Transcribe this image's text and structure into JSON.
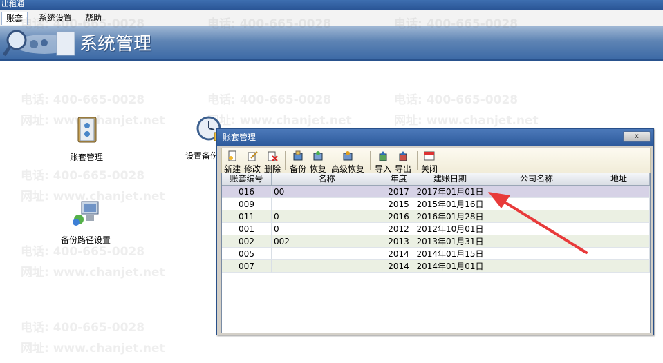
{
  "app": {
    "window_title": "出租通"
  },
  "menu": {
    "items": [
      "账套",
      "系统设置",
      "帮助"
    ]
  },
  "banner": {
    "title": "系统管理"
  },
  "watermark": {
    "phone": "电话: 400-665-0028",
    "site": "网址: www.chanjet.net"
  },
  "desktop": {
    "account_mgmt": "账套管理",
    "backup_settings": "设置备份",
    "backup_path": "备份路径设置"
  },
  "dialog": {
    "title": "账套管理",
    "close_label": "x",
    "toolbar": {
      "new": "新建",
      "edit": "修改",
      "delete": "删除",
      "backup": "备份",
      "restore": "恢复",
      "advanced_restore": "高级恢复",
      "import": "导入",
      "export": "导出",
      "close": "关闭"
    },
    "columns": [
      "账套编号",
      "名称",
      "年度",
      "建账日期",
      "公司名称",
      "地址"
    ],
    "rows": [
      {
        "code": "016",
        "name": "00",
        "year": "2017",
        "date": "2017年01月01日",
        "company": "",
        "address": ""
      },
      {
        "code": "009",
        "name": "",
        "year": "2015",
        "date": "2015年01月16日",
        "company": "",
        "address": ""
      },
      {
        "code": "011",
        "name": "0",
        "year": "2016",
        "date": "2016年01月28日",
        "company": "",
        "address": ""
      },
      {
        "code": "001",
        "name": "0",
        "year": "2012",
        "date": "2012年10月01日",
        "company": "",
        "address": ""
      },
      {
        "code": "002",
        "name": "002",
        "year": "2013",
        "date": "2013年01月31日",
        "company": "",
        "address": ""
      },
      {
        "code": "005",
        "name": "",
        "year": "2014",
        "date": "2014年01月15日",
        "company": "",
        "address": ""
      },
      {
        "code": "007",
        "name": "",
        "year": "2014",
        "date": "2014年01月01日",
        "company": "",
        "address": ""
      }
    ],
    "selected_row": 0
  },
  "colors": {
    "banner": "#3c6aa6",
    "dialog_title": "#2d5a9c",
    "arrow": "#e83a3a"
  }
}
